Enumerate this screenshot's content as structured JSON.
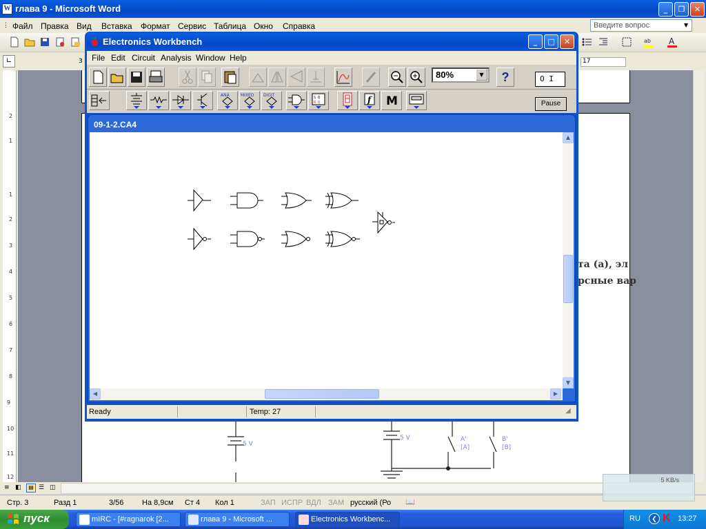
{
  "word": {
    "title": "глава 9 - Microsoft Word",
    "menu": [
      "Файл",
      "Правка",
      "Вид",
      "Вставка",
      "Формат",
      "Сервис",
      "Таблица",
      "Окно",
      "Справка"
    ],
    "ask_placeholder": "Введите вопрос",
    "ruler_left_mark": "3",
    "ruler_right_value": "17",
    "vruler_numbers": [
      "2",
      "1",
      "1",
      "2",
      "3",
      "4",
      "5",
      "6",
      "7",
      "8",
      "9",
      "10",
      "11",
      "12"
    ],
    "doc_text_line1": "та (a), эл",
    "doc_text_line2": "рсные вар",
    "status": {
      "page": "Стр. 3",
      "section": "Разд 1",
      "pages": "3/56",
      "at": "На 8,9см",
      "line": "Ст 4",
      "col": "Кол 1",
      "rec": "ЗАП",
      "trk": "ИСПР",
      "ext": "ВДЛ",
      "ovr": "ЗАМ",
      "language": "русский (Ро"
    },
    "net_speed": "5 KB/s"
  },
  "circuit_bg": {
    "label_5v_left": "5 V",
    "label_5v_right": "5 V",
    "switch_a": "A'",
    "switch_a_key": "[A]",
    "switch_b": "B'",
    "switch_b_key": "[B]"
  },
  "ewb": {
    "title": "Electronics Workbench",
    "menu": [
      "File",
      "Edit",
      "Circuit",
      "Analysis",
      "Window",
      "Help"
    ],
    "zoom": "80%",
    "help_label": "?",
    "bin_labels": {
      "analog": "ANA",
      "mixed": "MIXED",
      "digital": "DIGIT",
      "misc": "M"
    },
    "pause_label": "Pause",
    "power_label": "O I",
    "circuit_title": "09-1-2.CA4",
    "status": {
      "message": "Ready",
      "temp": "Temp:  27"
    }
  },
  "taskbar": {
    "start": "пуск",
    "tasks": [
      "mIRC - [#ragnarok [2...",
      "глава 9 - Microsoft ...",
      "Electronics Workbenc..."
    ],
    "lang": "RU",
    "clock": "13:27"
  },
  "colors": {
    "xp_blue": "#0a5fe0",
    "taskbar_blue": "#245edb",
    "start_green": "#3a9c3a",
    "ewb_panel": "#d4d0c8",
    "circuit_blue": "#7b86d6"
  }
}
